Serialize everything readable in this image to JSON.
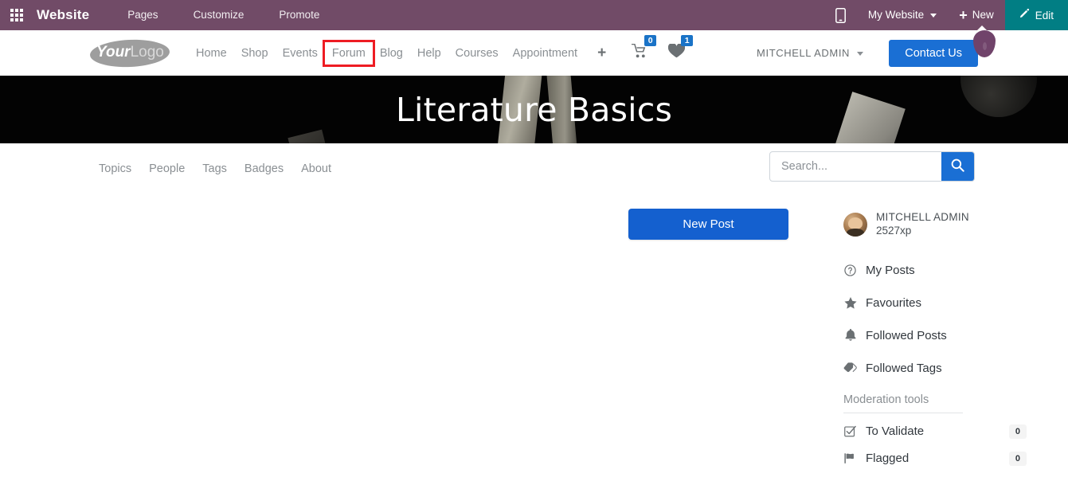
{
  "colors": {
    "odoo_purple": "#714B67",
    "edit_teal": "#017e84",
    "primary_blue": "#1a6fd4",
    "new_post_blue": "#1460cf",
    "badge_blue": "#1a73c7",
    "highlight_red": "#ee1c23",
    "hero_black": "#030303",
    "muted_grey": "#8a8f93"
  },
  "topbar": {
    "apps_icon": "apps-grid-icon",
    "brand": "Website",
    "menu": [
      {
        "label": "Pages"
      },
      {
        "label": "Customize"
      },
      {
        "label": "Promote"
      }
    ],
    "mobile_icon": "mobile-preview-icon",
    "site_selector": "My Website",
    "new_label": "New",
    "new_icon": "plus-icon",
    "edit_label": "Edit",
    "edit_icon": "pencil-icon"
  },
  "header": {
    "logo": {
      "bold": "Your",
      "light": "Logo"
    },
    "nav": [
      {
        "label": "Home",
        "highlighted": false
      },
      {
        "label": "Shop",
        "highlighted": false
      },
      {
        "label": "Events",
        "highlighted": false
      },
      {
        "label": "Forum",
        "highlighted": true
      },
      {
        "label": "Blog",
        "highlighted": false
      },
      {
        "label": "Help",
        "highlighted": false
      },
      {
        "label": "Courses",
        "highlighted": false
      },
      {
        "label": "Appointment",
        "highlighted": false
      }
    ],
    "add_page_icon": "plus-icon",
    "cart": {
      "icon": "shopping-cart-icon",
      "count": "0"
    },
    "wishlist": {
      "icon": "heart-icon",
      "count": "1"
    },
    "user_menu": "MITCHELL ADMIN",
    "contact_button": "Contact Us"
  },
  "hero": {
    "title": "Literature Basics"
  },
  "forum": {
    "tabs": [
      {
        "label": "Topics"
      },
      {
        "label": "People"
      },
      {
        "label": "Tags"
      },
      {
        "label": "Badges"
      },
      {
        "label": "About"
      }
    ],
    "search": {
      "placeholder": "Search...",
      "value": "",
      "button_icon": "search-icon"
    },
    "new_post_button": "New Post"
  },
  "sidebar": {
    "user": {
      "avatar": "user-avatar",
      "name": "MITCHELL ADMIN",
      "xp": "2527xp"
    },
    "links": [
      {
        "icon": "question-circle-icon",
        "label": "My Posts"
      },
      {
        "icon": "star-icon",
        "label": "Favourites"
      },
      {
        "icon": "bell-icon",
        "label": "Followed Posts"
      },
      {
        "icon": "tag-icon",
        "label": "Followed Tags"
      }
    ],
    "moderation": {
      "title": "Moderation tools",
      "items": [
        {
          "icon": "check-square-icon",
          "label": "To Validate",
          "count": "0"
        },
        {
          "icon": "flag-icon",
          "label": "Flagged",
          "count": "0"
        }
      ]
    }
  }
}
